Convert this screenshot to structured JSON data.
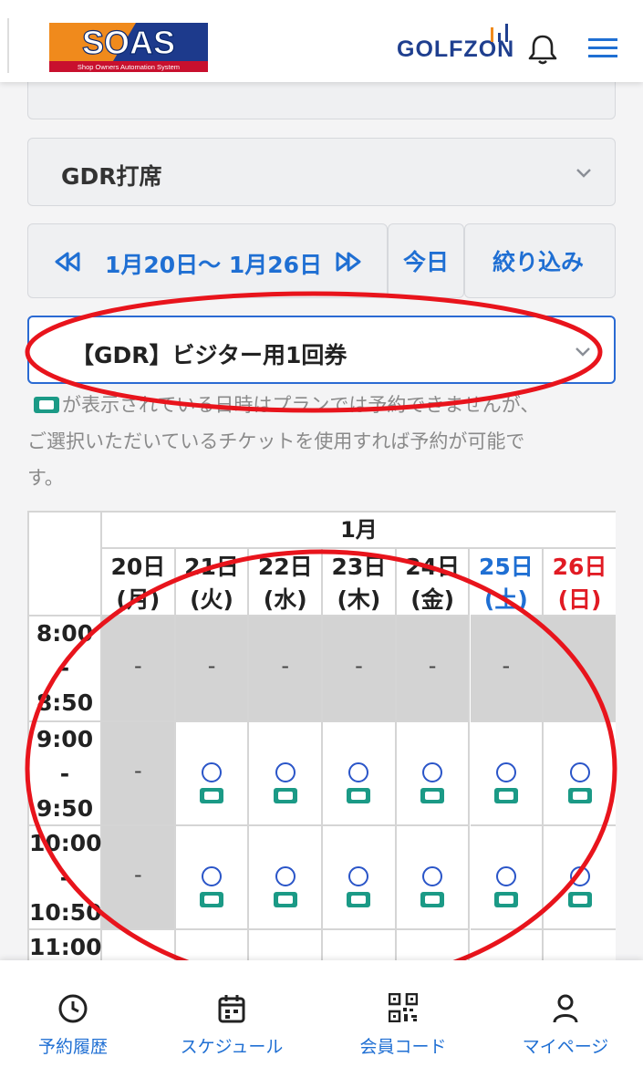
{
  "header": {
    "logo_main": "SOAS",
    "logo_sub": "Shop Owners Automation System",
    "brand": "GOLFZON"
  },
  "facility_select": {
    "value": "GDR打席"
  },
  "date_nav": {
    "range": "1月20日〜 1月26日",
    "today_label": "今日",
    "filter_label": "絞り込み"
  },
  "ticket_select": {
    "value": "【GDR】ビジター用1回券"
  },
  "note": {
    "line1": "が表示されている日時はプランでは予約できませんが、",
    "line2": "ご選択いただいているチケットを使用すれば予約が可能で",
    "line3": "す。"
  },
  "schedule": {
    "month": "1月",
    "days": [
      {
        "num": "20日",
        "dow": "(月)",
        "kind": "weekday"
      },
      {
        "num": "21日",
        "dow": "(火)",
        "kind": "weekday"
      },
      {
        "num": "22日",
        "dow": "(水)",
        "kind": "weekday"
      },
      {
        "num": "23日",
        "dow": "(木)",
        "kind": "weekday"
      },
      {
        "num": "24日",
        "dow": "(金)",
        "kind": "weekday"
      },
      {
        "num": "25日",
        "dow": "(土)",
        "kind": "sat"
      },
      {
        "num": "26日",
        "dow": "(日)",
        "kind": "sun"
      }
    ],
    "slots": [
      {
        "start": "8:00",
        "sep": "-",
        "end": "8:50",
        "cells": [
          "-",
          "-",
          "-",
          "-",
          "-",
          "-",
          ""
        ]
      },
      {
        "start": "9:00",
        "sep": "-",
        "end": "9:50",
        "cells": [
          "-",
          "○",
          "○",
          "○",
          "○",
          "○",
          "○"
        ]
      },
      {
        "start": "10:00",
        "sep": "-",
        "end": "10:50",
        "cells": [
          "-",
          "○",
          "○",
          "○",
          "○",
          "○",
          "○"
        ]
      },
      {
        "start": "11:00",
        "sep": "",
        "end": "",
        "cells": [
          "",
          "",
          "",
          "",
          "",
          "",
          ""
        ]
      }
    ]
  },
  "bottom_nav": [
    {
      "label": "予約履歴",
      "icon": "clock-icon"
    },
    {
      "label": "スケジュール",
      "icon": "calendar-icon"
    },
    {
      "label": "会員コード",
      "icon": "qr-code-icon"
    },
    {
      "label": "マイページ",
      "icon": "person-icon"
    }
  ],
  "colors": {
    "accent_blue": "#1f6fd3",
    "saturday": "#1f6fd3",
    "sunday": "#e11b24",
    "ticket_green": "#1b9a86",
    "annotation_red": "#e8141c",
    "unavailable_grey": "#d3d3d3"
  }
}
